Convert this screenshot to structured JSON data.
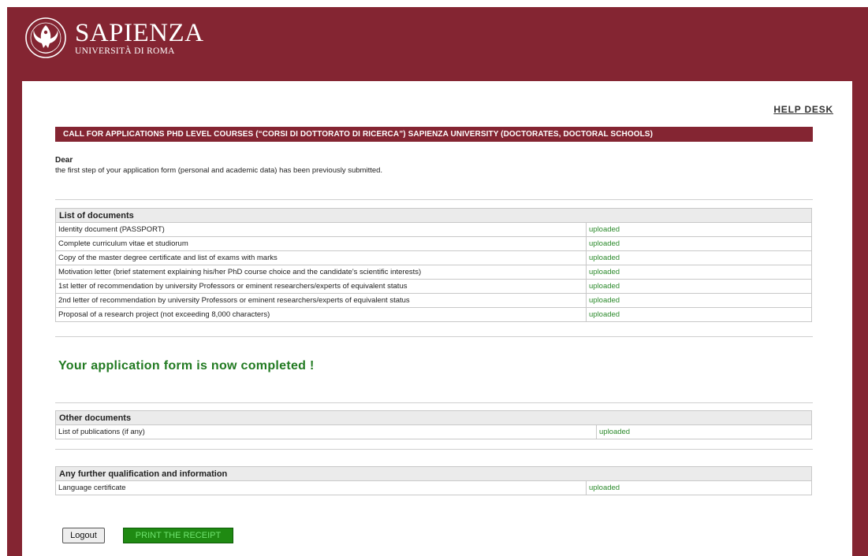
{
  "header": {
    "brand_name": "SAPIENZA",
    "brand_subtitle": "UNIVERSITÀ DI ROMA"
  },
  "help_desk": "HELP DESK",
  "banner": "CALL FOR APPLICATIONS PHD LEVEL COURSES (“CORSI DI DOTTORATO DI RICERCA”) SAPIENZA UNIVERSITY (DOCTORATES, DOCTORAL SCHOOLS)",
  "dear": "Dear",
  "intro": "the first step of your application form (personal and academic data) has been previously submitted.",
  "documents": {
    "title": "List of documents",
    "rows": [
      {
        "name": "Identity document (PASSPORT)",
        "status": "uploaded"
      },
      {
        "name": "Complete curriculum vitae et studiorum",
        "status": "uploaded"
      },
      {
        "name": "Copy of the master degree certificate and list of exams with marks",
        "status": "uploaded"
      },
      {
        "name": "Motivation letter (brief statement explaining his/her PhD course choice and the candidate's scientific interests)",
        "status": "uploaded"
      },
      {
        "name": "1st letter of recommendation by university Professors or eminent researchers/experts of equivalent status",
        "status": "uploaded"
      },
      {
        "name": "2nd letter of recommendation by university Professors or eminent researchers/experts of equivalent status",
        "status": "uploaded"
      },
      {
        "name": "Proposal of a research project (not exceeding 8,000 characters)",
        "status": "uploaded"
      }
    ]
  },
  "completion_message": "Your application form is now completed !",
  "other_documents": {
    "title": "Other documents",
    "rows": [
      {
        "name": "List of publications (if any)",
        "status": "uploaded"
      }
    ]
  },
  "further": {
    "title": "Any further qualification and information",
    "rows": [
      {
        "name": "Language certificate",
        "status": "uploaded"
      }
    ]
  },
  "buttons": {
    "logout": "Logout",
    "print": "PRINT THE RECEIPT"
  },
  "colors": {
    "brand": "#842532",
    "status_green": "#2b8a2b",
    "print_button": "#1f8a12"
  }
}
